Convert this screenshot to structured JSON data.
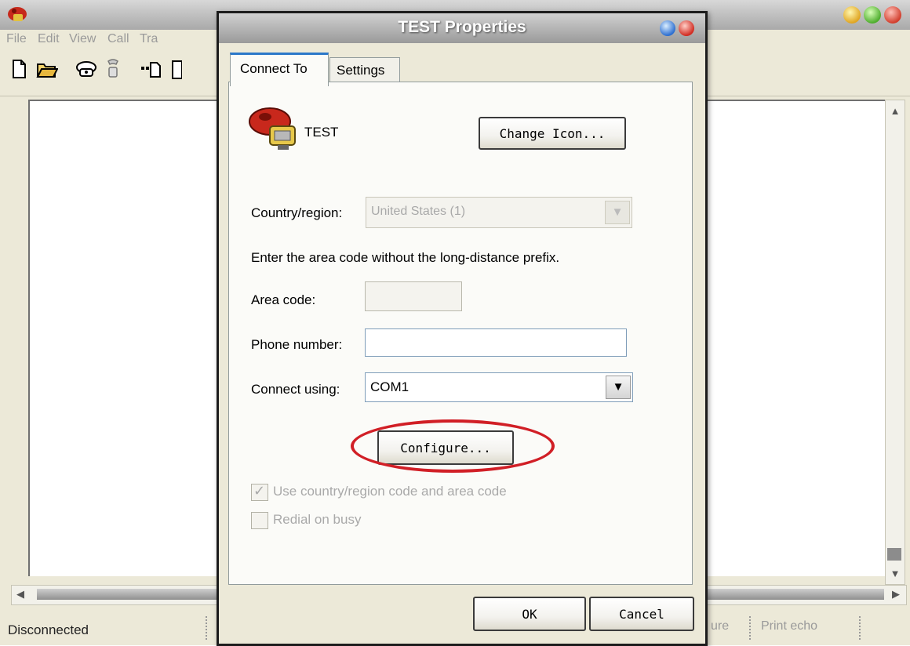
{
  "background_window": {
    "menu": [
      "File",
      "Edit",
      "View",
      "Call",
      "Tra"
    ],
    "status": {
      "connection": "Disconnected",
      "capture_partial": "ure",
      "print_echo": "Print echo"
    }
  },
  "dialog": {
    "title": "TEST Properties",
    "tabs": [
      {
        "label": "Connect To",
        "selected": true
      },
      {
        "label": "Settings",
        "selected": false
      }
    ],
    "connection_name": "TEST",
    "change_icon_label": "Change Icon...",
    "country": {
      "label": "Country/region:",
      "value": "United States (1)",
      "enabled": false
    },
    "area_instructions": "Enter the area code without the long-distance prefix.",
    "area_code": {
      "label": "Area code:",
      "value": "",
      "enabled": false
    },
    "phone_number": {
      "label": "Phone number:",
      "value": ""
    },
    "connect_using": {
      "label": "Connect using:",
      "value": "COM1"
    },
    "configure_label": "Configure...",
    "use_country_code": {
      "label": "Use country/region code and area code",
      "checked": true,
      "enabled": false
    },
    "redial_on_busy": {
      "label": "Redial on busy",
      "checked": false,
      "enabled": false
    },
    "ok_label": "OK",
    "cancel_label": "Cancel"
  },
  "colors": {
    "highlight_ellipse": "#d11f26",
    "selected_tab_accent": "#2b78c9",
    "dialog_face": "#ece9d8"
  },
  "icons": [
    "app-phone-icon",
    "new-icon",
    "open-icon",
    "connect-icon",
    "disconnect-icon",
    "send-icon",
    "properties-icon",
    "connection-phone-icon",
    "help-orb-icon",
    "close-orb-icon"
  ]
}
